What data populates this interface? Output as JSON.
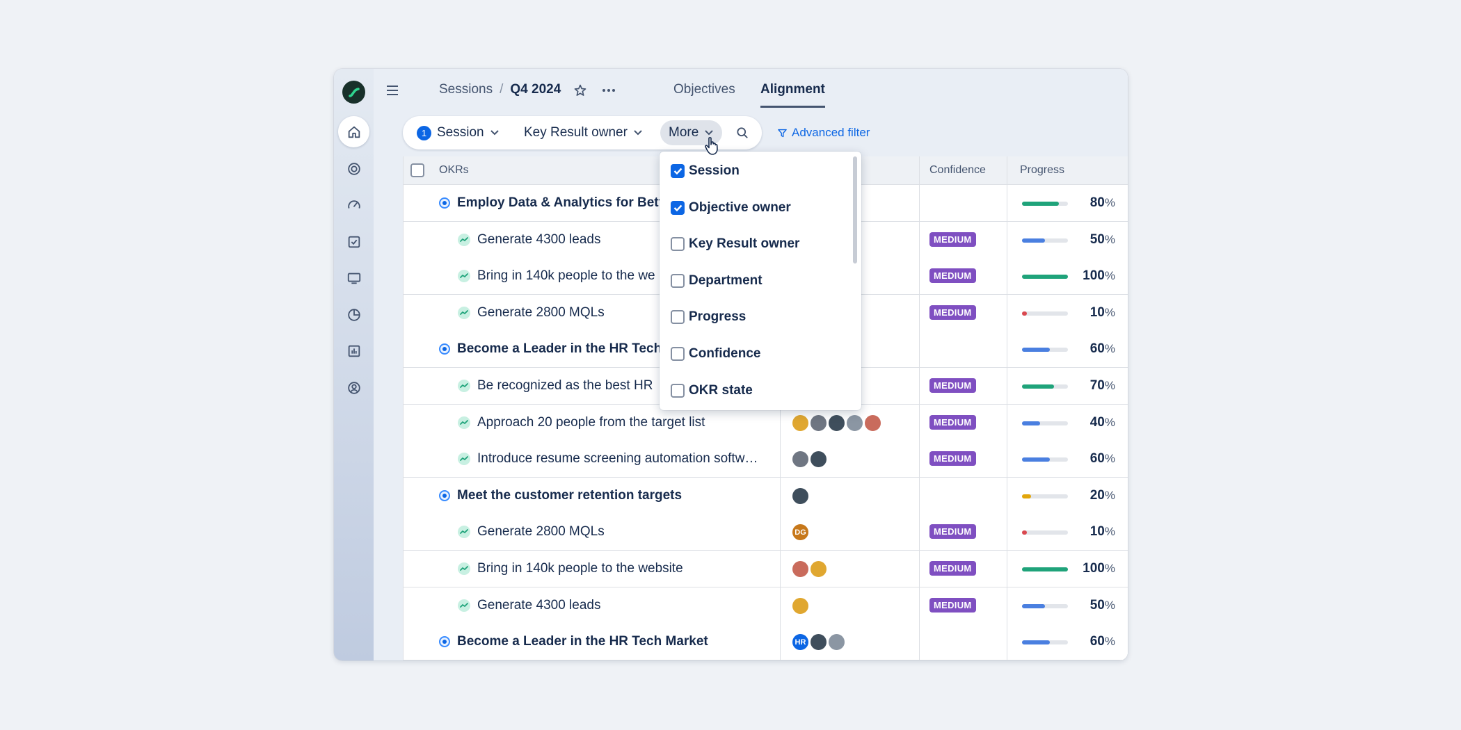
{
  "breadcrumb": {
    "root": "Sessions",
    "sep": "/",
    "current": "Q4 2024"
  },
  "tabs": [
    {
      "label": "Objectives",
      "active": false
    },
    {
      "label": "Alignment",
      "active": true
    }
  ],
  "filters": {
    "session": {
      "count": "1",
      "label": "Session"
    },
    "kr_owner": {
      "label": "Key Result owner"
    },
    "more": {
      "label": "More"
    },
    "advanced": "Advanced filter"
  },
  "columns": {
    "okrs": "OKRs",
    "confidence": "Confidence",
    "progress": "Progress"
  },
  "rows": [
    {
      "type": "objective",
      "name": "Employ Data & Analytics for Bett",
      "avatars": [],
      "confidence": "",
      "progress": "80",
      "progress_color": "#1fa37a"
    },
    {
      "type": "kr",
      "name": "Generate 4300 leads",
      "avatars": [],
      "confidence": "MEDIUM",
      "progress": "50",
      "progress_color": "#4a7fe0"
    },
    {
      "type": "kr",
      "name": "Bring in 140k people to the we",
      "avatars": [],
      "confidence": "MEDIUM",
      "progress": "100",
      "progress_color": "#1fa37a"
    },
    {
      "type": "kr",
      "name": "Generate 2800 MQLs",
      "avatars": [],
      "confidence": "MEDIUM",
      "progress": "10",
      "progress_color": "#d9484f"
    },
    {
      "type": "objective",
      "name": "Become a Leader in the HR Tech",
      "avatars": [],
      "confidence": "",
      "progress": "60",
      "progress_color": "#4a7fe0"
    },
    {
      "type": "kr",
      "name": "Be recognized as the best HR",
      "avatars": [],
      "confidence": "MEDIUM",
      "progress": "70",
      "progress_color": "#1fa37a"
    },
    {
      "type": "kr",
      "name": "Approach 20 people from the target list",
      "avatars": [
        "",
        "",
        "",
        "",
        ""
      ],
      "confidence": "MEDIUM",
      "progress": "40",
      "progress_color": "#4a7fe0"
    },
    {
      "type": "kr",
      "name": "Introduce resume screening automation softw…",
      "avatars": [
        "",
        ""
      ],
      "confidence": "MEDIUM",
      "progress": "60",
      "progress_color": "#4a7fe0"
    },
    {
      "type": "objective",
      "name": "Meet the customer retention targets",
      "avatars": [
        ""
      ],
      "confidence": "",
      "progress": "20",
      "progress_color": "#e2a60b"
    },
    {
      "type": "kr",
      "name": "Generate 2800 MQLs",
      "avatars": [
        "DG"
      ],
      "confidence": "MEDIUM",
      "progress": "10",
      "progress_color": "#d9484f"
    },
    {
      "type": "kr",
      "name": "Bring in 140k people to the website",
      "avatars": [
        "",
        ""
      ],
      "confidence": "MEDIUM",
      "progress": "100",
      "progress_color": "#1fa37a"
    },
    {
      "type": "kr",
      "name": "Generate 4300 leads",
      "avatars": [
        ""
      ],
      "confidence": "MEDIUM",
      "progress": "50",
      "progress_color": "#4a7fe0"
    },
    {
      "type": "objective",
      "name": "Become a Leader in the HR Tech Market",
      "avatars": [
        "HR",
        "",
        ""
      ],
      "confidence": "",
      "progress": "60",
      "progress_color": "#4a7fe0"
    }
  ],
  "pct_symbol": "%",
  "dropdown": {
    "items": [
      {
        "label": "Session",
        "checked": true
      },
      {
        "label": "Objective owner",
        "checked": true
      },
      {
        "label": "Key Result owner",
        "checked": false
      },
      {
        "label": "Department",
        "checked": false
      },
      {
        "label": "Progress",
        "checked": false
      },
      {
        "label": "Confidence",
        "checked": false
      },
      {
        "label": "OKR state",
        "checked": false
      }
    ]
  }
}
